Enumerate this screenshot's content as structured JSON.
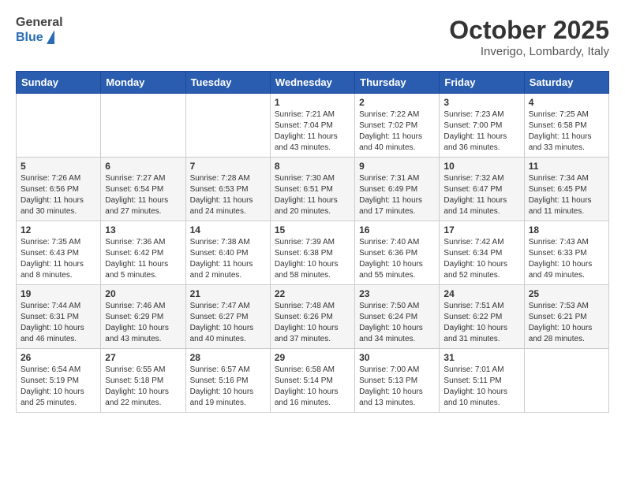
{
  "header": {
    "logo_general": "General",
    "logo_blue": "Blue",
    "month": "October 2025",
    "location": "Inverigo, Lombardy, Italy"
  },
  "days_of_week": [
    "Sunday",
    "Monday",
    "Tuesday",
    "Wednesday",
    "Thursday",
    "Friday",
    "Saturday"
  ],
  "weeks": [
    [
      {
        "day": "",
        "content": ""
      },
      {
        "day": "",
        "content": ""
      },
      {
        "day": "",
        "content": ""
      },
      {
        "day": "1",
        "content": "Sunrise: 7:21 AM\nSunset: 7:04 PM\nDaylight: 11 hours and 43 minutes."
      },
      {
        "day": "2",
        "content": "Sunrise: 7:22 AM\nSunset: 7:02 PM\nDaylight: 11 hours and 40 minutes."
      },
      {
        "day": "3",
        "content": "Sunrise: 7:23 AM\nSunset: 7:00 PM\nDaylight: 11 hours and 36 minutes."
      },
      {
        "day": "4",
        "content": "Sunrise: 7:25 AM\nSunset: 6:58 PM\nDaylight: 11 hours and 33 minutes."
      }
    ],
    [
      {
        "day": "5",
        "content": "Sunrise: 7:26 AM\nSunset: 6:56 PM\nDaylight: 11 hours and 30 minutes."
      },
      {
        "day": "6",
        "content": "Sunrise: 7:27 AM\nSunset: 6:54 PM\nDaylight: 11 hours and 27 minutes."
      },
      {
        "day": "7",
        "content": "Sunrise: 7:28 AM\nSunset: 6:53 PM\nDaylight: 11 hours and 24 minutes."
      },
      {
        "day": "8",
        "content": "Sunrise: 7:30 AM\nSunset: 6:51 PM\nDaylight: 11 hours and 20 minutes."
      },
      {
        "day": "9",
        "content": "Sunrise: 7:31 AM\nSunset: 6:49 PM\nDaylight: 11 hours and 17 minutes."
      },
      {
        "day": "10",
        "content": "Sunrise: 7:32 AM\nSunset: 6:47 PM\nDaylight: 11 hours and 14 minutes."
      },
      {
        "day": "11",
        "content": "Sunrise: 7:34 AM\nSunset: 6:45 PM\nDaylight: 11 hours and 11 minutes."
      }
    ],
    [
      {
        "day": "12",
        "content": "Sunrise: 7:35 AM\nSunset: 6:43 PM\nDaylight: 11 hours and 8 minutes."
      },
      {
        "day": "13",
        "content": "Sunrise: 7:36 AM\nSunset: 6:42 PM\nDaylight: 11 hours and 5 minutes."
      },
      {
        "day": "14",
        "content": "Sunrise: 7:38 AM\nSunset: 6:40 PM\nDaylight: 11 hours and 2 minutes."
      },
      {
        "day": "15",
        "content": "Sunrise: 7:39 AM\nSunset: 6:38 PM\nDaylight: 10 hours and 58 minutes."
      },
      {
        "day": "16",
        "content": "Sunrise: 7:40 AM\nSunset: 6:36 PM\nDaylight: 10 hours and 55 minutes."
      },
      {
        "day": "17",
        "content": "Sunrise: 7:42 AM\nSunset: 6:34 PM\nDaylight: 10 hours and 52 minutes."
      },
      {
        "day": "18",
        "content": "Sunrise: 7:43 AM\nSunset: 6:33 PM\nDaylight: 10 hours and 49 minutes."
      }
    ],
    [
      {
        "day": "19",
        "content": "Sunrise: 7:44 AM\nSunset: 6:31 PM\nDaylight: 10 hours and 46 minutes."
      },
      {
        "day": "20",
        "content": "Sunrise: 7:46 AM\nSunset: 6:29 PM\nDaylight: 10 hours and 43 minutes."
      },
      {
        "day": "21",
        "content": "Sunrise: 7:47 AM\nSunset: 6:27 PM\nDaylight: 10 hours and 40 minutes."
      },
      {
        "day": "22",
        "content": "Sunrise: 7:48 AM\nSunset: 6:26 PM\nDaylight: 10 hours and 37 minutes."
      },
      {
        "day": "23",
        "content": "Sunrise: 7:50 AM\nSunset: 6:24 PM\nDaylight: 10 hours and 34 minutes."
      },
      {
        "day": "24",
        "content": "Sunrise: 7:51 AM\nSunset: 6:22 PM\nDaylight: 10 hours and 31 minutes."
      },
      {
        "day": "25",
        "content": "Sunrise: 7:53 AM\nSunset: 6:21 PM\nDaylight: 10 hours and 28 minutes."
      }
    ],
    [
      {
        "day": "26",
        "content": "Sunrise: 6:54 AM\nSunset: 5:19 PM\nDaylight: 10 hours and 25 minutes."
      },
      {
        "day": "27",
        "content": "Sunrise: 6:55 AM\nSunset: 5:18 PM\nDaylight: 10 hours and 22 minutes."
      },
      {
        "day": "28",
        "content": "Sunrise: 6:57 AM\nSunset: 5:16 PM\nDaylight: 10 hours and 19 minutes."
      },
      {
        "day": "29",
        "content": "Sunrise: 6:58 AM\nSunset: 5:14 PM\nDaylight: 10 hours and 16 minutes."
      },
      {
        "day": "30",
        "content": "Sunrise: 7:00 AM\nSunset: 5:13 PM\nDaylight: 10 hours and 13 minutes."
      },
      {
        "day": "31",
        "content": "Sunrise: 7:01 AM\nSunset: 5:11 PM\nDaylight: 10 hours and 10 minutes."
      },
      {
        "day": "",
        "content": ""
      }
    ]
  ]
}
